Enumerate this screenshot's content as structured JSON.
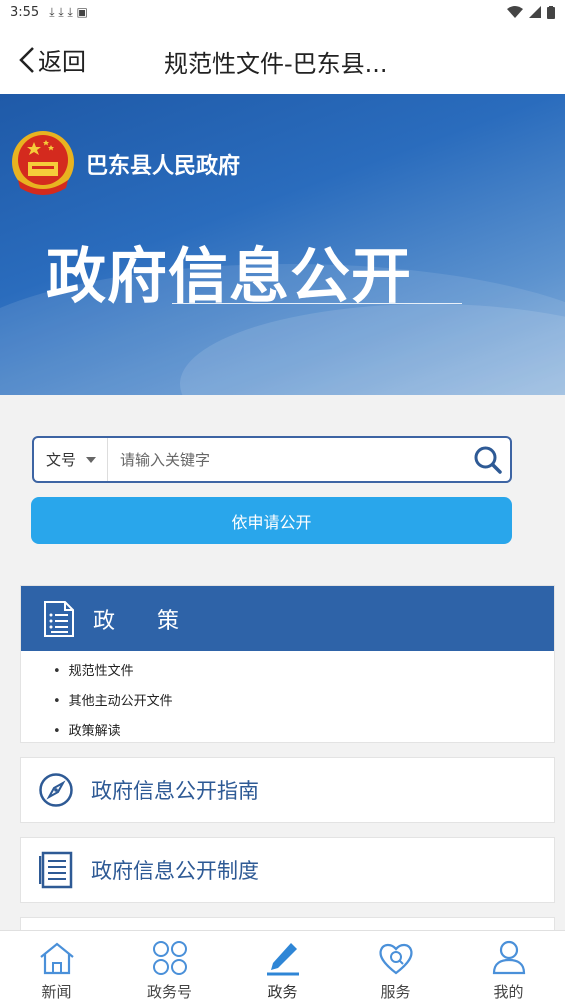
{
  "status": {
    "time": "3:55",
    "notifications": "⤓ ⤓ ⤓ ▣"
  },
  "header": {
    "back_label": "返回",
    "title": "规范性文件-巴东县..."
  },
  "banner": {
    "gov_name": "巴东县人民政府",
    "title": "政府信息公开"
  },
  "search": {
    "select_value": "文号",
    "placeholder": "请输入关键字"
  },
  "apply_button": "依申请公开",
  "policy": {
    "header": "政策",
    "items": [
      "规范性文件",
      "其他主动公开文件",
      "政策解读"
    ]
  },
  "cards": [
    {
      "label": "政府信息公开指南"
    },
    {
      "label": "政府信息公开制度"
    }
  ],
  "tabs": [
    {
      "label": "新闻"
    },
    {
      "label": "政务号"
    },
    {
      "label": "政务"
    },
    {
      "label": "服务"
    },
    {
      "label": "我的"
    }
  ],
  "colors": {
    "primary": "#2e63a8",
    "accent": "#29a6eb",
    "tab_icon": "#4a90d9"
  }
}
